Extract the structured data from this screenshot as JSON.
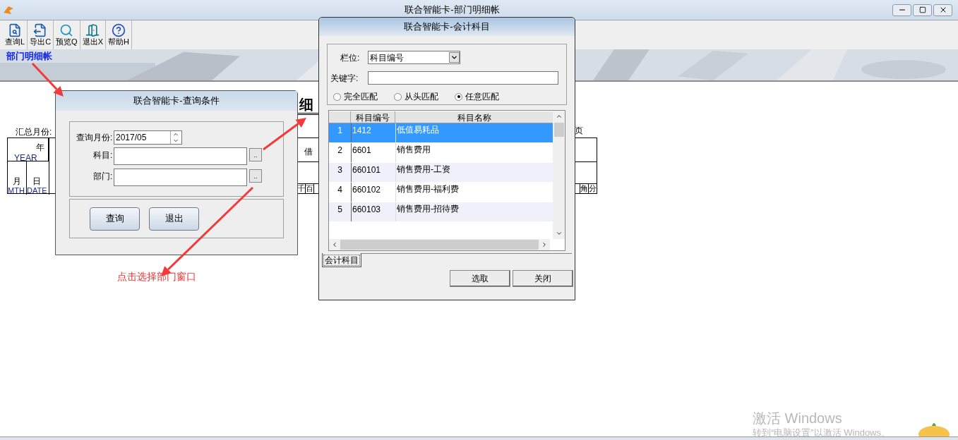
{
  "window": {
    "title": "联合智能卡-部门明细帐"
  },
  "toolbar": [
    {
      "kind": "query",
      "label": "查询L"
    },
    {
      "kind": "export",
      "label": "导出C"
    },
    {
      "kind": "preview",
      "label": "预览Q"
    },
    {
      "kind": "exit",
      "label": "退出X"
    },
    {
      "kind": "help",
      "label": "帮助H"
    }
  ],
  "banner": {
    "title": "部门明细帐"
  },
  "report": {
    "title_fragment": "细",
    "summary_month_label": "汇总月份:",
    "page_fragment": "页",
    "year": "年",
    "year_en": "YEAR",
    "month": "月",
    "month_en": "MTH",
    "day": "日",
    "day_en": "DATE",
    "debit_fragment": "借",
    "digits_left": [
      "千",
      "百"
    ],
    "digits_right": [
      "角",
      "分"
    ]
  },
  "query_dialog": {
    "title": "联合智能卡-查询条件",
    "month_label": "查询月份:",
    "month_value": "2017/05",
    "subject_label": "科目:",
    "dept_label": "部门:",
    "browse_button": "..",
    "buttons": [
      "查询",
      "退出"
    ]
  },
  "subject_dialog": {
    "title": "联合智能卡-会计科目",
    "field_label": "栏位:",
    "field_value": "科目编号",
    "keyword_label": "关键字:",
    "match_modes": [
      {
        "label": "完全匹配",
        "selected": false
      },
      {
        "label": "从头匹配",
        "selected": false
      },
      {
        "label": "任意匹配",
        "selected": true
      }
    ],
    "columns": [
      "科目编号",
      "科目名称"
    ],
    "rows": [
      {
        "index": "1",
        "code": "1412",
        "name": "低值易耗品",
        "selected": true
      },
      {
        "index": "2",
        "code": "6601",
        "name": "销售费用",
        "selected": false
      },
      {
        "index": "3",
        "code": "660101",
        "name": "销售费用-工资",
        "selected": false
      },
      {
        "index": "4",
        "code": "660102",
        "name": "销售费用-福利费",
        "selected": false
      },
      {
        "index": "5",
        "code": "660103",
        "name": "销售费用-招待费",
        "selected": false
      }
    ],
    "tab": {
      "label": "会计科目",
      "selected": true
    },
    "buttons": [
      "选取",
      "关闭"
    ]
  },
  "annotation": {
    "text": "点击选择部门窗口"
  },
  "activation_notice": {
    "title": "激活 Windows",
    "text": "转到“电脑设置”以激活 Windows。"
  }
}
